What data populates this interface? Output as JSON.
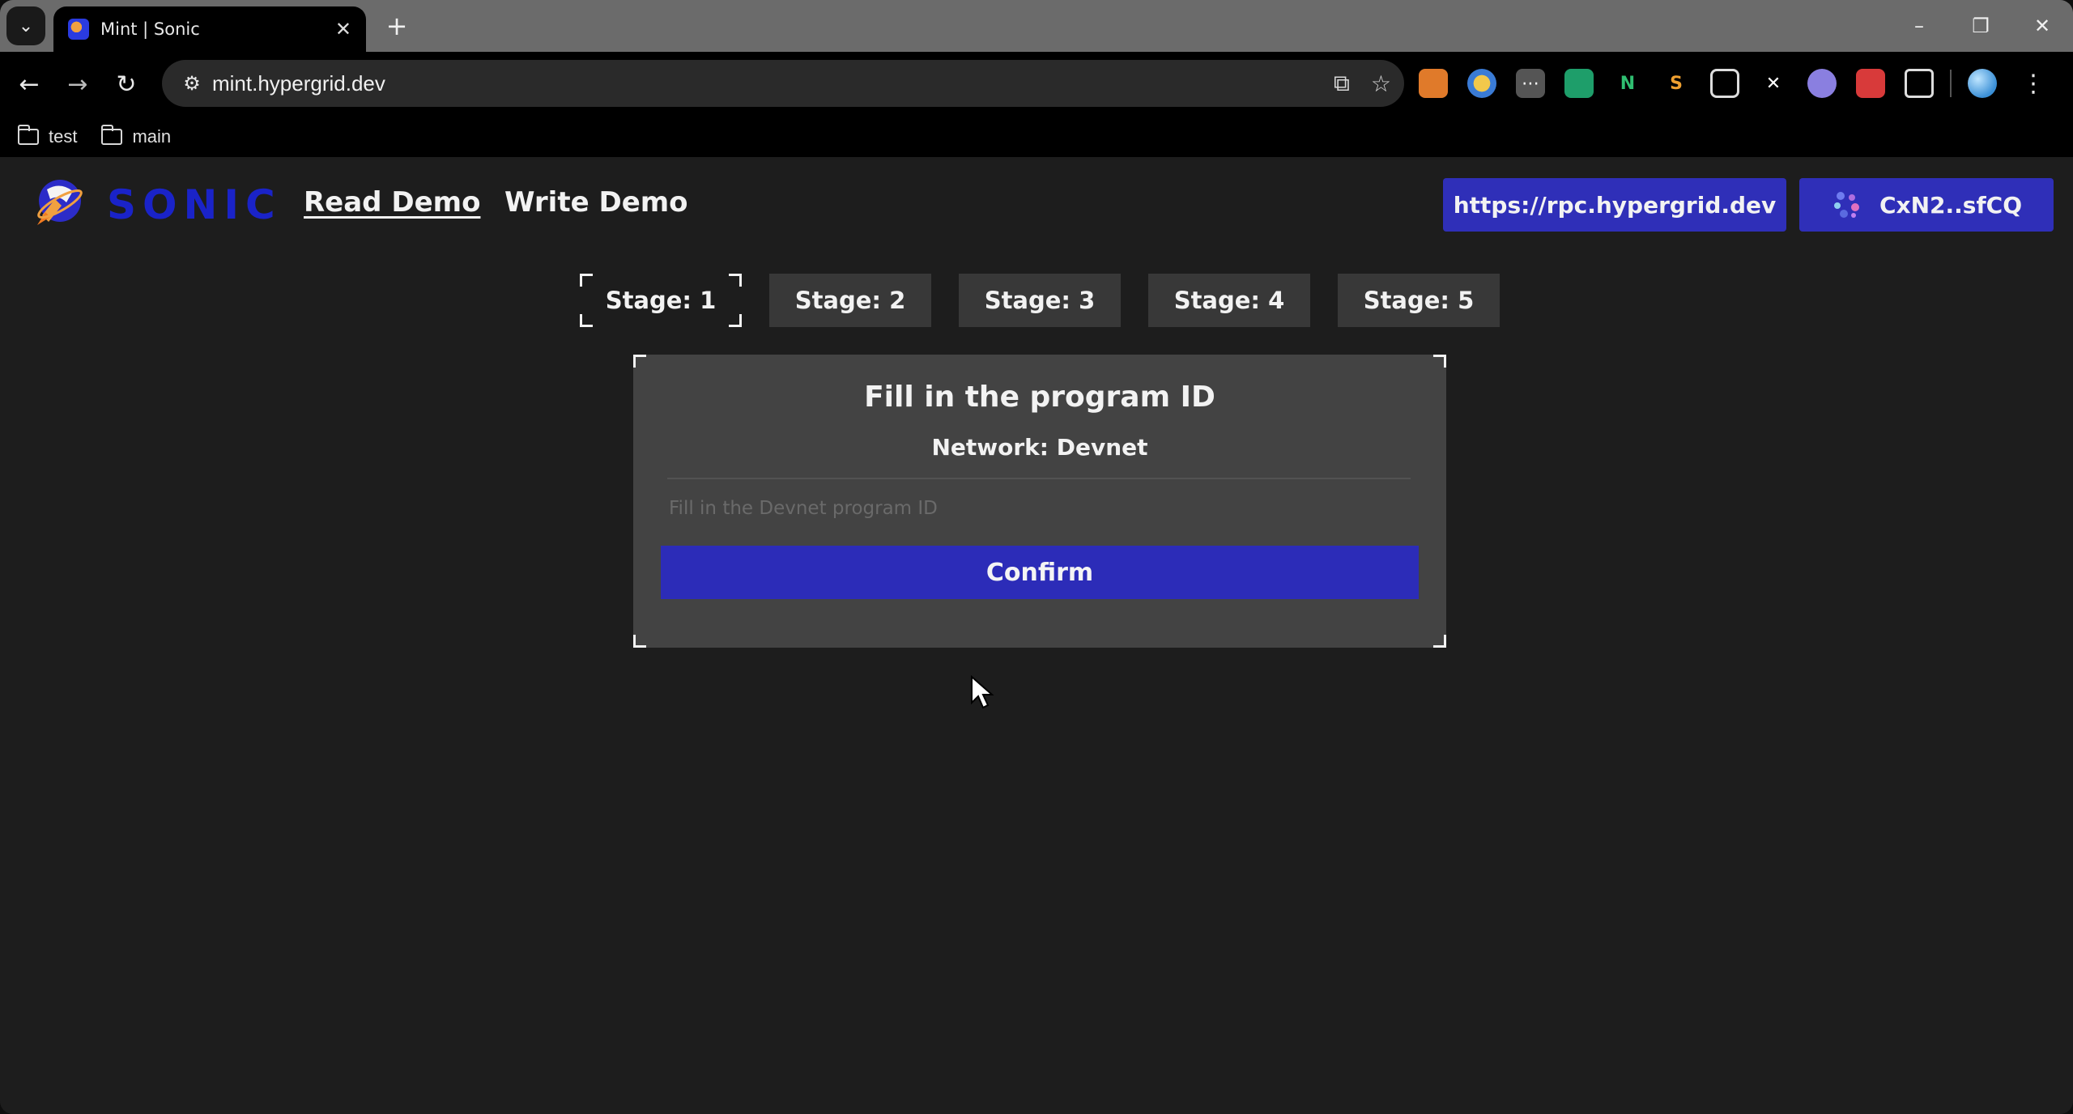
{
  "browser": {
    "tab": {
      "title": "Mint | Sonic"
    },
    "address": {
      "url": "mint.hypergrid.dev"
    },
    "bookmarks": [
      {
        "label": "test"
      },
      {
        "label": "main"
      }
    ]
  },
  "header": {
    "brand": "SONIC",
    "nav": {
      "read": "Read Demo",
      "write": "Write Demo"
    },
    "rpc_url": "https://rpc.hypergrid.dev",
    "wallet": "CxN2..sfCQ"
  },
  "stages": [
    {
      "label": "Stage: 1",
      "active": true
    },
    {
      "label": "Stage: 2",
      "active": false
    },
    {
      "label": "Stage: 3",
      "active": false
    },
    {
      "label": "Stage: 4",
      "active": false
    },
    {
      "label": "Stage: 5",
      "active": false
    }
  ],
  "card": {
    "title": "Fill in the program ID",
    "network": "Network: Devnet",
    "input_placeholder": "Fill in the Devnet program ID",
    "input_value": "",
    "confirm_label": "Confirm"
  },
  "colors": {
    "brand_blue": "#1a23c8",
    "button_blue": "#2c2cb8",
    "page_bg": "#1d1d1d",
    "card_bg": "#434343"
  }
}
